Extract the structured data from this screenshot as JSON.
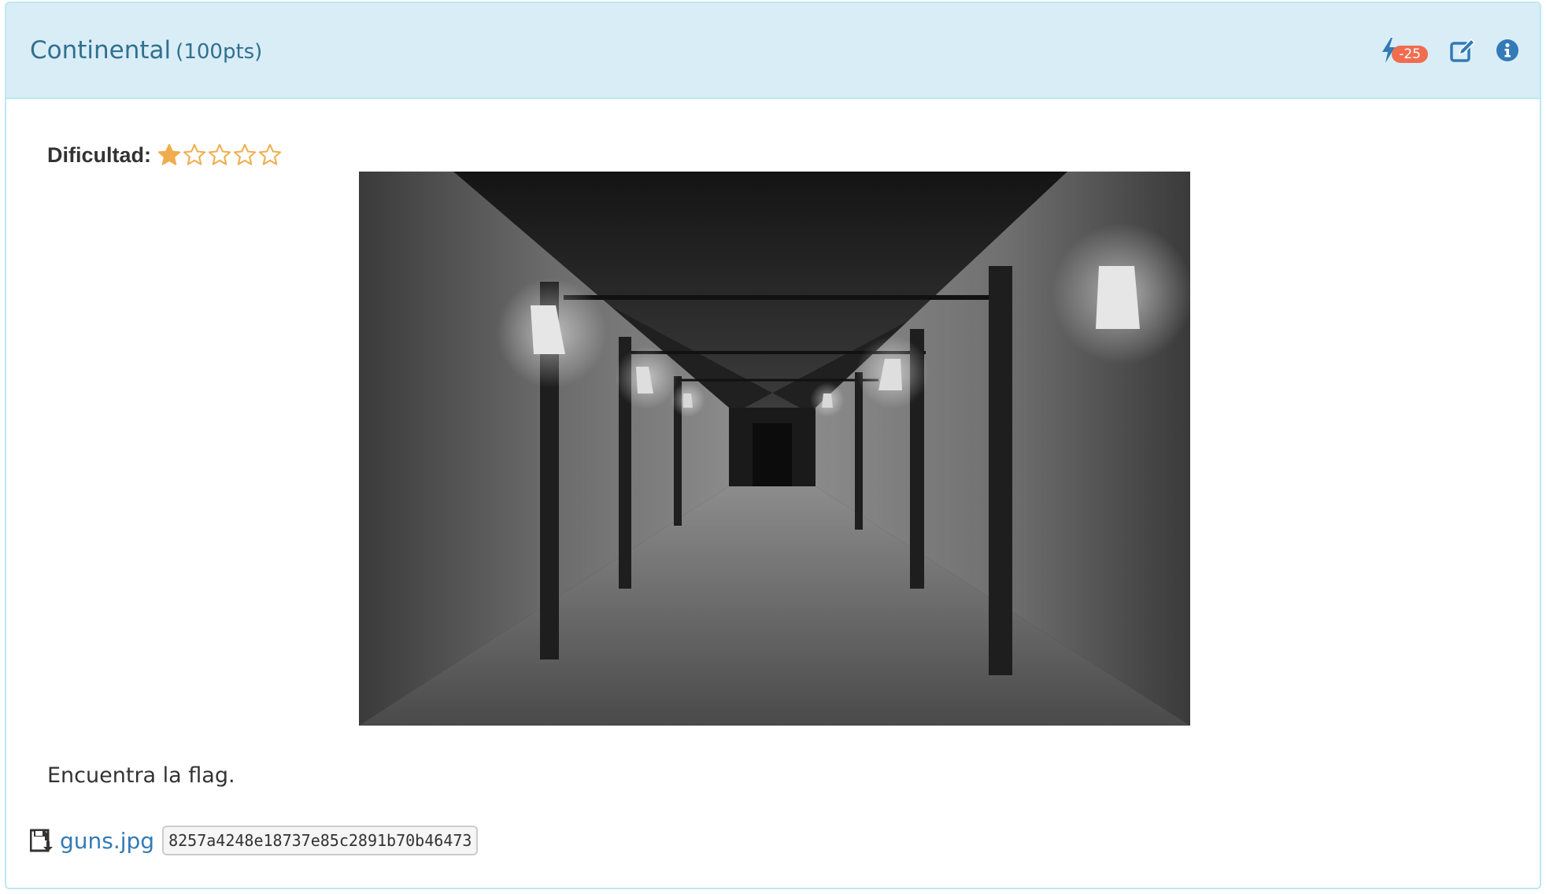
{
  "challenge": {
    "name": "Continental",
    "points": "(100pts)",
    "hint_badge": "-25",
    "hint_icon": "bolt-icon",
    "edit_icon": "edit-icon",
    "info_icon": "info-circle-icon"
  },
  "difficulty": {
    "label": "Dificultad:",
    "rating": 1,
    "max": 5,
    "star_color": "#f0ad4e"
  },
  "image": {
    "alt": "hallway-photo"
  },
  "description": "Encuentra la flag.",
  "file": {
    "icon": "download-icon",
    "name": "guns.jpg",
    "hash": "8257a4248e18737e85c2891b70b46473"
  },
  "colors": {
    "heading_bg": "#d9edf7",
    "heading_border": "#bce8f1",
    "title_color": "#31708f",
    "badge_bg": "#f06d4f",
    "link_color": "#337ab7",
    "icon_color": "#337ab7"
  }
}
